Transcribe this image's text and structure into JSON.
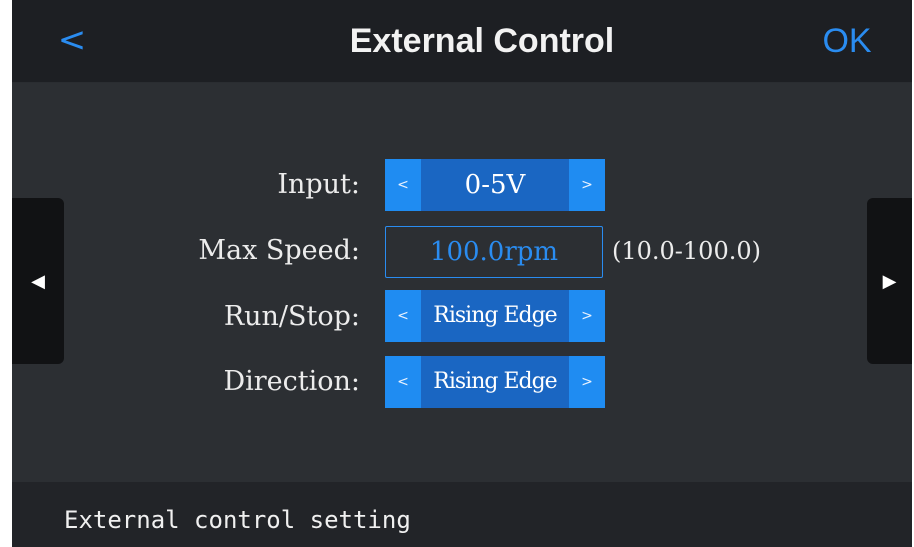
{
  "header": {
    "back_icon": "<",
    "title": "External Control",
    "ok_label": "OK"
  },
  "side_nav": {
    "prev_icon": "◀",
    "next_icon": "▶"
  },
  "form": {
    "input": {
      "label": "Input:",
      "value": "0-5V",
      "prev": "<",
      "next": ">"
    },
    "max_speed": {
      "label": "Max Speed:",
      "value": "100.0rpm",
      "range": "(10.0-100.0)"
    },
    "run_stop": {
      "label": "Run/Stop:",
      "value": "Rising Edge",
      "prev": "<",
      "next": ">"
    },
    "direction": {
      "label": "Direction:",
      "value": "Rising Edge",
      "prev": "<",
      "next": ">"
    }
  },
  "footer": {
    "status": "External control setting"
  },
  "colors": {
    "accent": "#2a8cf0",
    "selected_bg": "#1a66c2",
    "background": "#2c2f33",
    "header_bg": "#1d1f23"
  }
}
